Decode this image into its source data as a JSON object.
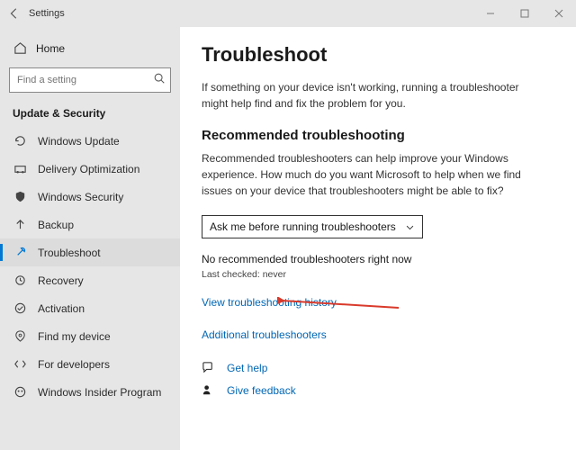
{
  "titlebar": {
    "title": "Settings"
  },
  "home": {
    "label": "Home"
  },
  "search": {
    "placeholder": "Find a setting"
  },
  "category": "Update & Security",
  "nav": {
    "items": [
      {
        "label": "Windows Update"
      },
      {
        "label": "Delivery Optimization"
      },
      {
        "label": "Windows Security"
      },
      {
        "label": "Backup"
      },
      {
        "label": "Troubleshoot"
      },
      {
        "label": "Recovery"
      },
      {
        "label": "Activation"
      },
      {
        "label": "Find my device"
      },
      {
        "label": "For developers"
      },
      {
        "label": "Windows Insider Program"
      }
    ]
  },
  "main": {
    "heading": "Troubleshoot",
    "intro": "If something on your device isn't working, running a troubleshooter might help find and fix the problem for you.",
    "rec_heading": "Recommended troubleshooting",
    "rec_text": "Recommended troubleshooters can help improve your Windows experience. How much do you want Microsoft to help when we find issues on your device that troubleshooters might be able to fix?",
    "dropdown": "Ask me before running troubleshooters",
    "status": "No recommended troubleshooters right now",
    "last_checked": "Last checked: never",
    "history_link": "View troubleshooting history",
    "additional_link": "Additional troubleshooters",
    "get_help": "Get help",
    "give_feedback": "Give feedback"
  }
}
